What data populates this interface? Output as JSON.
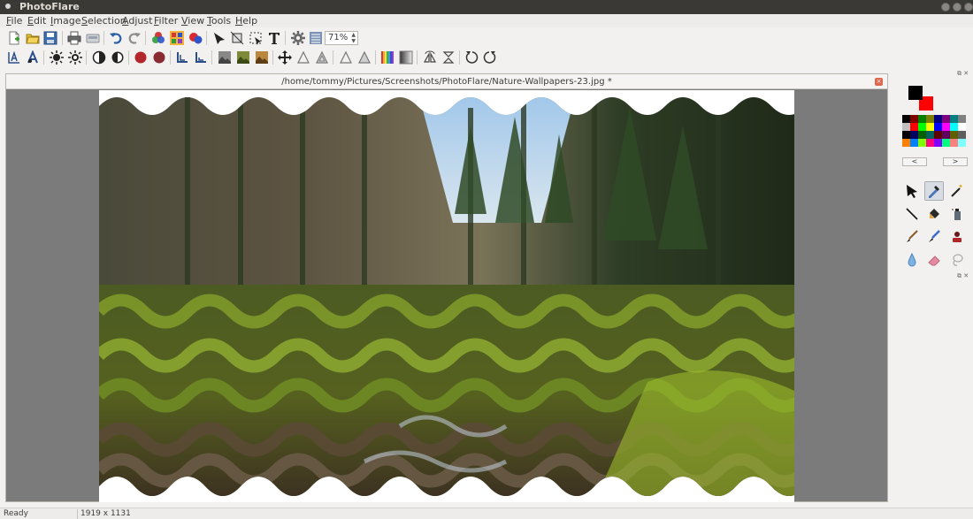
{
  "window": {
    "title": "PhotoFlare"
  },
  "menu": {
    "items": [
      "File",
      "Edit",
      "Image",
      "Selection",
      "Adjust",
      "Filter",
      "View",
      "Tools",
      "Help"
    ]
  },
  "toolbar": {
    "zoom_value": "71%"
  },
  "document": {
    "title": "/home/tommy/Pictures/Screenshots/PhotoFlare/Nature-Wallpapers-23.jpg *"
  },
  "palette": {
    "primary_color": "#000000",
    "secondary_color": "#ff0000",
    "colors": [
      "#000000",
      "#800000",
      "#008000",
      "#808000",
      "#000080",
      "#800080",
      "#008080",
      "#808080",
      "#c0c0c0",
      "#ff0000",
      "#00ff00",
      "#ffff00",
      "#0000ff",
      "#ff00ff",
      "#00ffff",
      "#ffffff",
      "#000000",
      "#00005f",
      "#005f00",
      "#005f5f",
      "#5f0000",
      "#5f005f",
      "#5f5f00",
      "#5f5f5f",
      "#ff8000",
      "#0080ff",
      "#80ff00",
      "#ff0080",
      "#8000ff",
      "#00ff80",
      "#ff8080",
      "#80ffff"
    ],
    "prev_label": "<",
    "next_label": ">"
  },
  "statusbar": {
    "status": "Ready",
    "dimensions": "1919 x 1131"
  }
}
